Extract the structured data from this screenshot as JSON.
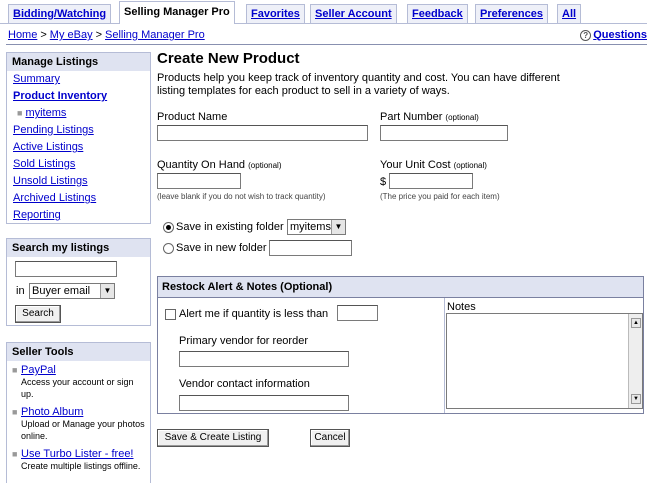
{
  "tabs": [
    "Bidding/Watching",
    "Selling Manager Pro",
    "Favorites",
    "Seller Account",
    "Feedback",
    "Preferences",
    "All"
  ],
  "breadcrumb": [
    "Home",
    "My eBay",
    "Selling Manager Pro"
  ],
  "breadcrumb_sep": ">",
  "help_label": "Questions",
  "sidebar": {
    "manage": {
      "heading": "Manage Listings",
      "items": [
        "Summary",
        "Product Inventory",
        "myitems",
        "Pending Listings",
        "Active Listings",
        "Sold Listings",
        "Unsold Listings",
        "Archived Listings",
        "Reporting"
      ]
    },
    "search": {
      "heading": "Search my listings",
      "in_label": "in",
      "select_value": "Buyer email",
      "button": "Search"
    },
    "tools": {
      "heading": "Seller Tools",
      "items": [
        {
          "label": "PayPal",
          "desc": "Access your account or sign up."
        },
        {
          "label": "Photo Album",
          "desc": "Upload or Manage your photos online."
        },
        {
          "label": "Use Turbo Lister - free!",
          "desc": "Create multiple listings offline."
        }
      ]
    }
  },
  "form": {
    "title": "Create New Product",
    "intro": "Products help you keep track of inventory quantity and cost. You can have different listing templates for each product to sell in a variety of ways.",
    "product_name_label": "Product Name",
    "part_number_label": "Part Number",
    "optional": "(optional)",
    "quantity_label": "Quantity On Hand",
    "quantity_hint": "(leave blank if you do not wish to track quantity)",
    "unit_cost_label": "Your Unit Cost",
    "currency": "$",
    "unit_cost_hint": "(The price you paid for each item)",
    "save_existing_label": "Save in existing folder",
    "folder_value": "myitems",
    "save_new_label": "Save in new folder",
    "restock": {
      "heading": "Restock Alert & Notes (Optional)",
      "alert_label": "Alert me if quantity is less than",
      "vendor_label": "Primary vendor for reorder",
      "contact_label": "Vendor contact information",
      "notes_label": "Notes"
    },
    "save_button": "Save & Create Listing",
    "cancel_button": "Cancel"
  }
}
